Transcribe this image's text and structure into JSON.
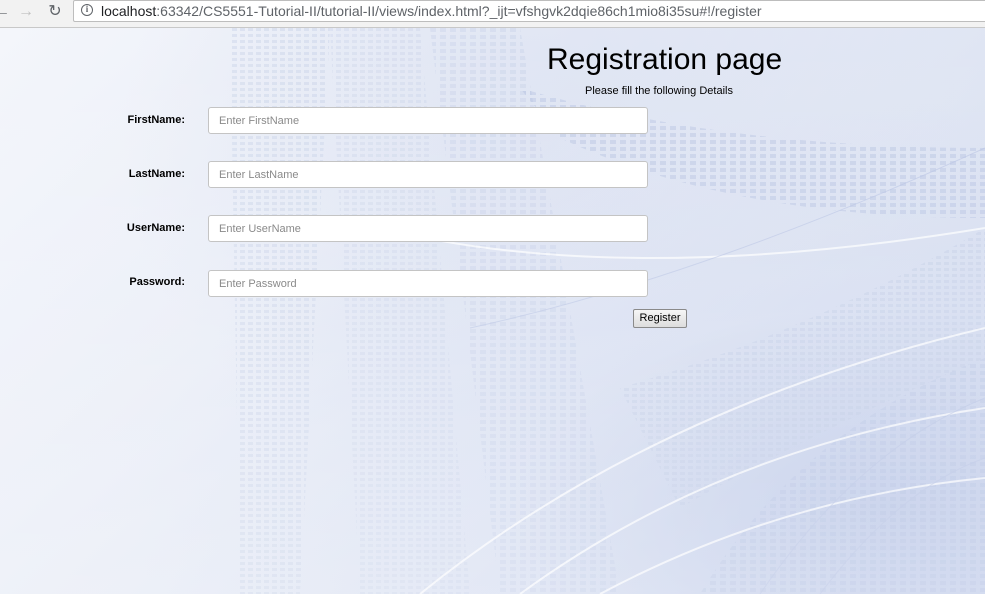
{
  "browser": {
    "back_glyph": "←",
    "forward_glyph": "→",
    "reload_glyph": "↻",
    "info_glyph": "i",
    "url_host": "localhost",
    "url_rest": ":63342/CS5551-Tutorial-II/tutorial-II/views/index.html?_ijt=vfshgvk2dqie86ch1mio8i35su#!/register"
  },
  "page": {
    "title": "Registration page",
    "subtitle": "Please fill the following Details"
  },
  "form": {
    "fields": [
      {
        "label": "FirstName:",
        "placeholder": "Enter FirstName",
        "value": ""
      },
      {
        "label": "LastName:",
        "placeholder": "Enter LastName",
        "value": ""
      },
      {
        "label": "UserName:",
        "placeholder": "Enter UserName",
        "value": ""
      },
      {
        "label": "Password:",
        "placeholder": "Enter Password",
        "value": ""
      }
    ],
    "register_label": "Register"
  }
}
